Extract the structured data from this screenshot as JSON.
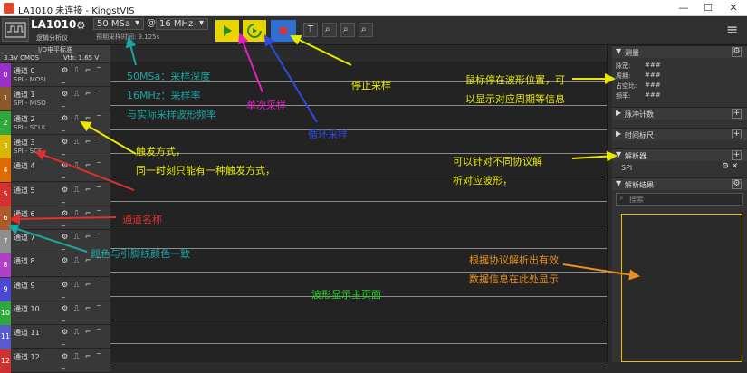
{
  "window": {
    "title": "LA1010 未连接 - KingstVIS"
  },
  "toolbar": {
    "device_name": "LA1010",
    "device_subtitle": "逻辑分析仪",
    "sample_depth": "50 MSa",
    "sample_rate": "16 MHz",
    "sample_time": "预期采样时间: 3.125s"
  },
  "io": {
    "header": "I/O电平标准",
    "level": "3.3V CMOS",
    "vth": "Vth: 1.65 V"
  },
  "channels": [
    {
      "num": "0",
      "name": "通道 0",
      "sub": "SPI - MOSI",
      "color": "#9b30c8"
    },
    {
      "num": "1",
      "name": "通道 1",
      "sub": "SPI - MISO",
      "color": "#8a5a2b"
    },
    {
      "num": "2",
      "name": "通道 2",
      "sub": "SPI - SCLK",
      "color": "#2fa83c"
    },
    {
      "num": "3",
      "name": "通道 3",
      "sub": "SPI - SCS",
      "color": "#d6b800"
    },
    {
      "num": "4",
      "name": "通道 4",
      "sub": "",
      "color": "#e06a00"
    },
    {
      "num": "5",
      "name": "通道 5",
      "sub": "",
      "color": "#d63030"
    },
    {
      "num": "6",
      "name": "通道 6",
      "sub": "",
      "color": "#b05a2a"
    },
    {
      "num": "7",
      "name": "通道 7",
      "sub": "",
      "color": "#8f8f8f"
    },
    {
      "num": "8",
      "name": "通道 8",
      "sub": "",
      "color": "#b040c8"
    },
    {
      "num": "9",
      "name": "通道 9",
      "sub": "",
      "color": "#4a4ad0"
    },
    {
      "num": "10",
      "name": "通道 10",
      "sub": "",
      "color": "#2fa83c"
    },
    {
      "num": "11",
      "name": "通道 11",
      "sub": "",
      "color": "#5a5ad0"
    },
    {
      "num": "12",
      "name": "通道 12",
      "sub": "",
      "color": "#cc3030"
    }
  ],
  "right_panel": {
    "measure": {
      "title": "测量",
      "labels": [
        "脉宽:",
        "周期:",
        "占空比:",
        "频率:"
      ],
      "values": [
        "###",
        "###",
        "###",
        "###"
      ]
    },
    "pulse_count": "脉冲计数",
    "time_marks": "时间标尺",
    "analyzer": {
      "title": "解析器",
      "item": "SPI"
    },
    "results": {
      "title": "解析结果",
      "search_placeholder": "搜索"
    }
  },
  "annotations": {
    "depth": "50MSa：采样深度",
    "rate": "16MHz：采样率",
    "time": "与实际采样波形频率",
    "single": "单次采样",
    "loop": "循环采样",
    "stop": "停止采样",
    "cursor1": "鼠标停在波形位置，可",
    "cursor2": "以显示对应周期等信息",
    "trigger1": "触发方式，",
    "trigger2": "同一时刻只能有一种触发方式，",
    "chname": "通道名称",
    "color": "颜色与引脚线颜色一致",
    "proto1": "可以针对不同协议解",
    "proto2": "析对应波形，",
    "data1": "根据协议解析出有效",
    "data2": "数据信息在此处显示",
    "main": "波形显示主页面"
  },
  "colors": {
    "teal": "#1aa6a0",
    "magenta": "#e020c0",
    "blue": "#2e4adf",
    "yellow": "#e8e800",
    "red": "#e03030",
    "orange": "#e89020",
    "green": "#22d522"
  }
}
